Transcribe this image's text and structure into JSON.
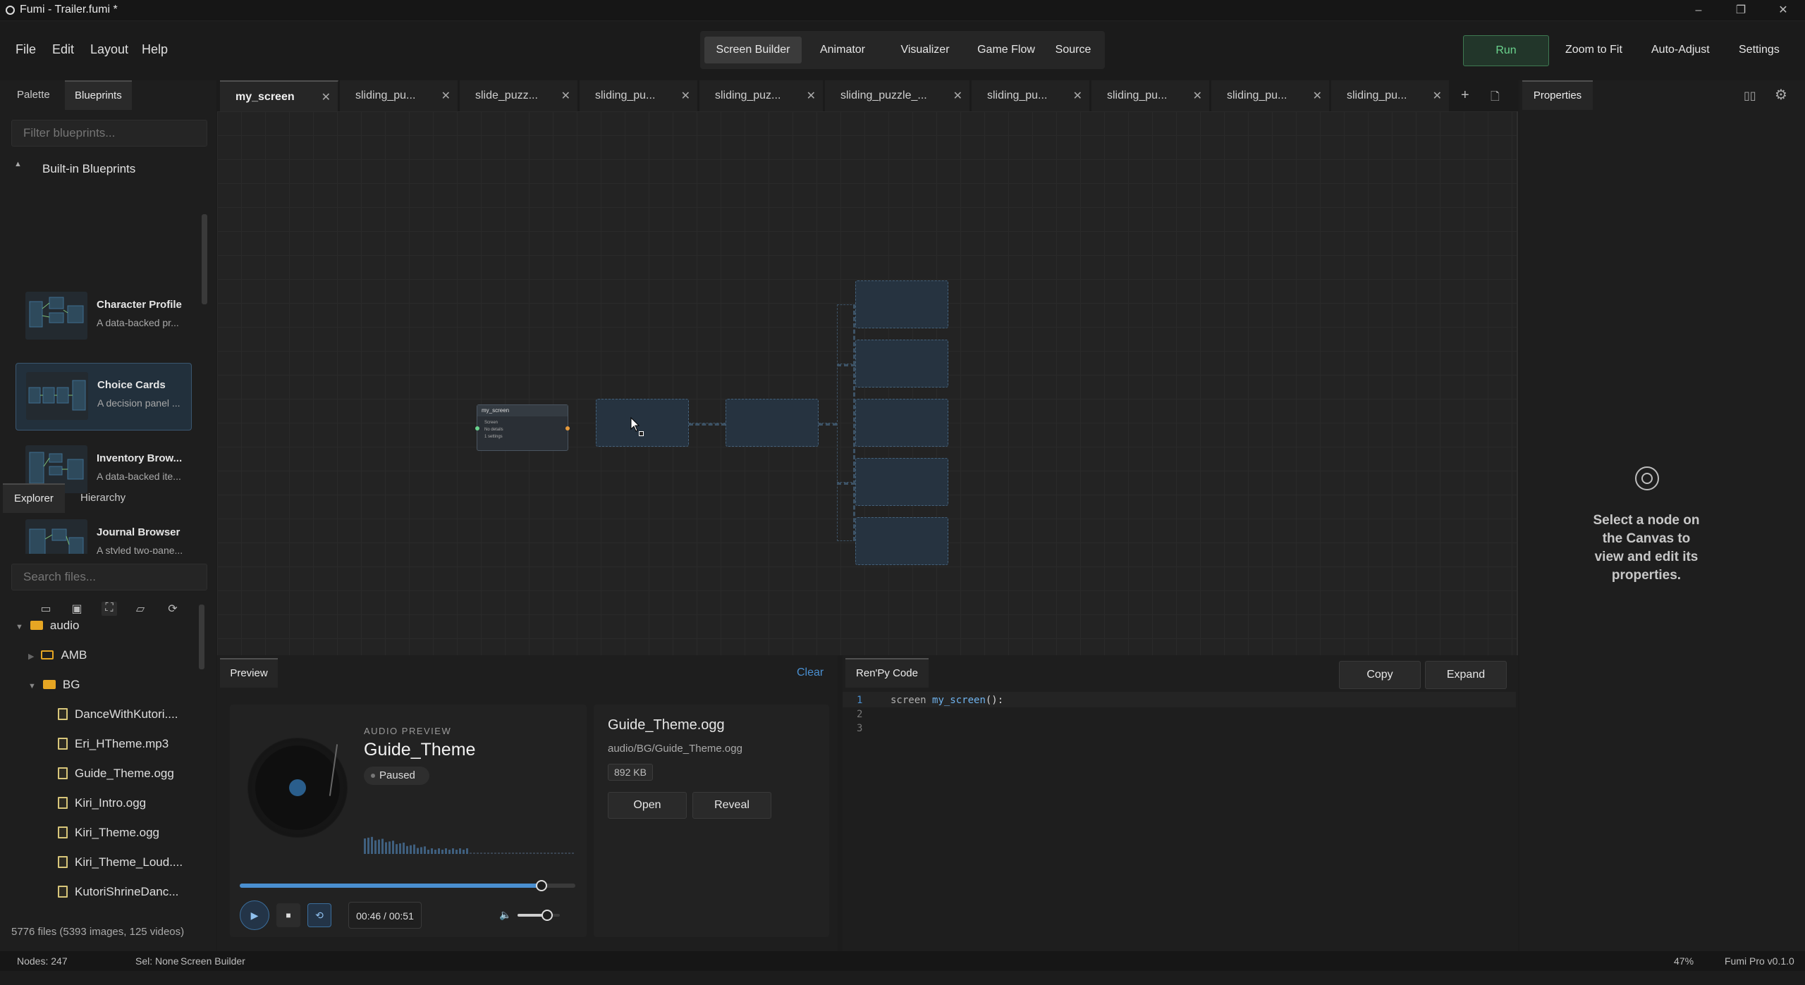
{
  "window": {
    "title": "Fumi - Trailer.fumi *",
    "minimize": "–",
    "restore": "❐",
    "close": "✕"
  },
  "menu": {
    "file": "File",
    "edit": "Edit",
    "layout": "Layout",
    "help": "Help"
  },
  "modes": [
    "Screen Builder",
    "Animator",
    "Visualizer",
    "Game Flow",
    "Source"
  ],
  "active_mode": "Screen Builder",
  "toolbar_right": {
    "run": "Run",
    "zoom_to_fit": "Zoom to Fit",
    "auto_adjust": "Auto-Adjust",
    "settings": "Settings"
  },
  "left_tabs": {
    "palette": "Palette",
    "blueprints": "Blueprints"
  },
  "blueprints": {
    "filter_placeholder": "Filter blueprints...",
    "section": "Built-in Blueprints",
    "items": [
      {
        "title": "Character Profile",
        "desc": "A data-backed pr..."
      },
      {
        "title": "Choice Cards",
        "desc": "A decision panel ..."
      },
      {
        "title": "Inventory Brow...",
        "desc": "A data-backed ite..."
      },
      {
        "title": "Journal Browser",
        "desc": "A styled two-pane..."
      }
    ]
  },
  "explorer_tabs": {
    "explorer": "Explorer",
    "hierarchy": "Hierarchy"
  },
  "explorer": {
    "search_placeholder": "Search files...",
    "tree": [
      {
        "name": "audio",
        "type": "folder"
      },
      {
        "name": "AMB",
        "type": "folder"
      },
      {
        "name": "BG",
        "type": "folder-open"
      },
      {
        "name": "DanceWithKutori....",
        "type": "file"
      },
      {
        "name": "Eri_HTheme.mp3",
        "type": "file"
      },
      {
        "name": "Guide_Theme.ogg",
        "type": "file"
      },
      {
        "name": "Kiri_Intro.ogg",
        "type": "file"
      },
      {
        "name": "Kiri_Theme.ogg",
        "type": "file"
      },
      {
        "name": "Kiri_Theme_Loud....",
        "type": "file"
      },
      {
        "name": "KutoriShrineDanc...",
        "type": "file"
      }
    ],
    "footer": "5776 files (5393 images, 125 videos)"
  },
  "doc_tabs": [
    "my_screen",
    "sliding_pu...",
    "slide_puzz...",
    "sliding_pu...",
    "sliding_puz...",
    "sliding_puzzle_...",
    "sliding_pu...",
    "sliding_pu...",
    "sliding_pu...",
    "sliding_pu..."
  ],
  "canvas": {
    "root_node": {
      "title": "my_screen",
      "lines": [
        "Screen",
        "No details",
        "1 settings"
      ]
    }
  },
  "preview": {
    "tab": "Preview",
    "clear": "Clear",
    "audio_label": "AUDIO PREVIEW",
    "track": "Guide_Theme",
    "status": "Paused",
    "time": "00:46 / 00:51",
    "progress": 0.9,
    "volume": 0.7,
    "file_name": "Guide_Theme.ogg",
    "file_path": "audio/BG/Guide_Theme.ogg",
    "file_size": "892 KB",
    "open": "Open",
    "reveal": "Reveal"
  },
  "code": {
    "tab": "Ren'Py Code",
    "copy": "Copy",
    "expand": "Expand",
    "line_numbers": [
      "1",
      "2",
      "3"
    ],
    "line1_kw": "screen",
    "line1_name": "my_screen",
    "line1_rest": "():"
  },
  "properties": {
    "tab": "Properties",
    "empty_msg": "Select a node on the Canvas to view and edit its properties."
  },
  "status": {
    "nodes": "Nodes: 247",
    "sel": "Sel: None",
    "mode": "Screen Builder",
    "zoom": "47%",
    "version": "Fumi Pro v0.1.0"
  },
  "colors": {
    "accent_green": "#6ad38d",
    "accent_blue": "#4a8fd0",
    "folder": "#e6a623"
  }
}
